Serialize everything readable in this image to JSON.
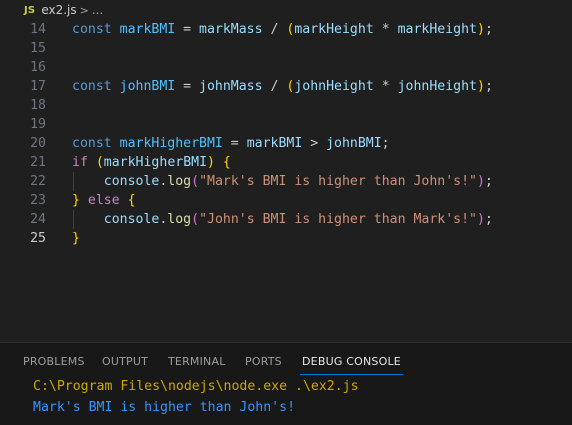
{
  "breadcrumb": {
    "lang_badge": "JS",
    "file": "ex2.js",
    "chevron": ">",
    "more": "..."
  },
  "editor": {
    "lines": [
      {
        "n": "14",
        "active": false,
        "tokens": [
          {
            "t": "const ",
            "c": "kw"
          },
          {
            "t": "markBMI",
            "c": "var"
          },
          {
            "t": " = ",
            "c": "op"
          },
          {
            "t": "markMass",
            "c": "vr2"
          },
          {
            "t": " / ",
            "c": "op"
          },
          {
            "t": "(",
            "c": "br1"
          },
          {
            "t": "markHeight",
            "c": "vr2"
          },
          {
            "t": " * ",
            "c": "op"
          },
          {
            "t": "markHeight",
            "c": "vr2"
          },
          {
            "t": ")",
            "c": "br1"
          },
          {
            "t": ";",
            "c": "op"
          }
        ]
      },
      {
        "n": "15",
        "active": false,
        "tokens": []
      },
      {
        "n": "16",
        "active": false,
        "tokens": []
      },
      {
        "n": "17",
        "active": false,
        "tokens": [
          {
            "t": "const ",
            "c": "kw"
          },
          {
            "t": "johnBMI",
            "c": "var"
          },
          {
            "t": " = ",
            "c": "op"
          },
          {
            "t": "johnMass",
            "c": "vr2"
          },
          {
            "t": " / ",
            "c": "op"
          },
          {
            "t": "(",
            "c": "br1"
          },
          {
            "t": "johnHeight",
            "c": "vr2"
          },
          {
            "t": " * ",
            "c": "op"
          },
          {
            "t": "johnHeight",
            "c": "vr2"
          },
          {
            "t": ")",
            "c": "br1"
          },
          {
            "t": ";",
            "c": "op"
          }
        ]
      },
      {
        "n": "18",
        "active": false,
        "tokens": []
      },
      {
        "n": "19",
        "active": false,
        "tokens": []
      },
      {
        "n": "20",
        "active": false,
        "tokens": [
          {
            "t": "const ",
            "c": "kw"
          },
          {
            "t": "markHigherBMI",
            "c": "var"
          },
          {
            "t": " = ",
            "c": "op"
          },
          {
            "t": "markBMI",
            "c": "vr2"
          },
          {
            "t": " > ",
            "c": "op"
          },
          {
            "t": "johnBMI",
            "c": "vr2"
          },
          {
            "t": ";",
            "c": "op"
          }
        ]
      },
      {
        "n": "21",
        "active": false,
        "tokens": [
          {
            "t": "if",
            "c": "ctl"
          },
          {
            "t": " ",
            "c": "op"
          },
          {
            "t": "(",
            "c": "br1"
          },
          {
            "t": "markHigherBMI",
            "c": "vr2"
          },
          {
            "t": ")",
            "c": "br1"
          },
          {
            "t": " ",
            "c": "op"
          },
          {
            "t": "{",
            "c": "br1"
          }
        ]
      },
      {
        "n": "22",
        "active": false,
        "tokens": [
          {
            "t": "    ",
            "c": "op"
          },
          {
            "t": "console",
            "c": "vr2"
          },
          {
            "t": ".",
            "c": "op"
          },
          {
            "t": "log",
            "c": "fn"
          },
          {
            "t": "(",
            "c": "br2"
          },
          {
            "t": "\"Mark's BMI is higher than John's!\"",
            "c": "str"
          },
          {
            "t": ")",
            "c": "br2"
          },
          {
            "t": ";",
            "c": "op"
          }
        ]
      },
      {
        "n": "23",
        "active": false,
        "tokens": [
          {
            "t": "}",
            "c": "br1"
          },
          {
            "t": " ",
            "c": "op"
          },
          {
            "t": "else",
            "c": "ctl"
          },
          {
            "t": " ",
            "c": "op"
          },
          {
            "t": "{",
            "c": "br1"
          }
        ]
      },
      {
        "n": "24",
        "active": false,
        "tokens": [
          {
            "t": "    ",
            "c": "op"
          },
          {
            "t": "console",
            "c": "vr2"
          },
          {
            "t": ".",
            "c": "op"
          },
          {
            "t": "log",
            "c": "fn"
          },
          {
            "t": "(",
            "c": "br2"
          },
          {
            "t": "\"John's BMI is higher than Mark's!\"",
            "c": "str"
          },
          {
            "t": ")",
            "c": "br2"
          },
          {
            "t": ";",
            "c": "op"
          }
        ]
      },
      {
        "n": "25",
        "active": true,
        "tokens": [
          {
            "t": "}",
            "c": "br1"
          }
        ]
      }
    ]
  },
  "panel": {
    "tabs": [
      {
        "label": "PROBLEMS",
        "active": false
      },
      {
        "label": "OUTPUT",
        "active": false
      },
      {
        "label": "TERMINAL",
        "active": false
      },
      {
        "label": "PORTS",
        "active": false
      },
      {
        "label": "DEBUG CONSOLE",
        "active": true
      }
    ],
    "console": {
      "command": "C:\\Program Files\\nodejs\\node.exe .\\ex2.js",
      "output": "Mark's BMI is higher than John's!"
    }
  },
  "colors": {
    "background": "#1f1f1f",
    "panel_background": "#181818",
    "active_tab_underline": "#0078d4",
    "command_text": "#cca700",
    "output_text": "#3794ff"
  }
}
